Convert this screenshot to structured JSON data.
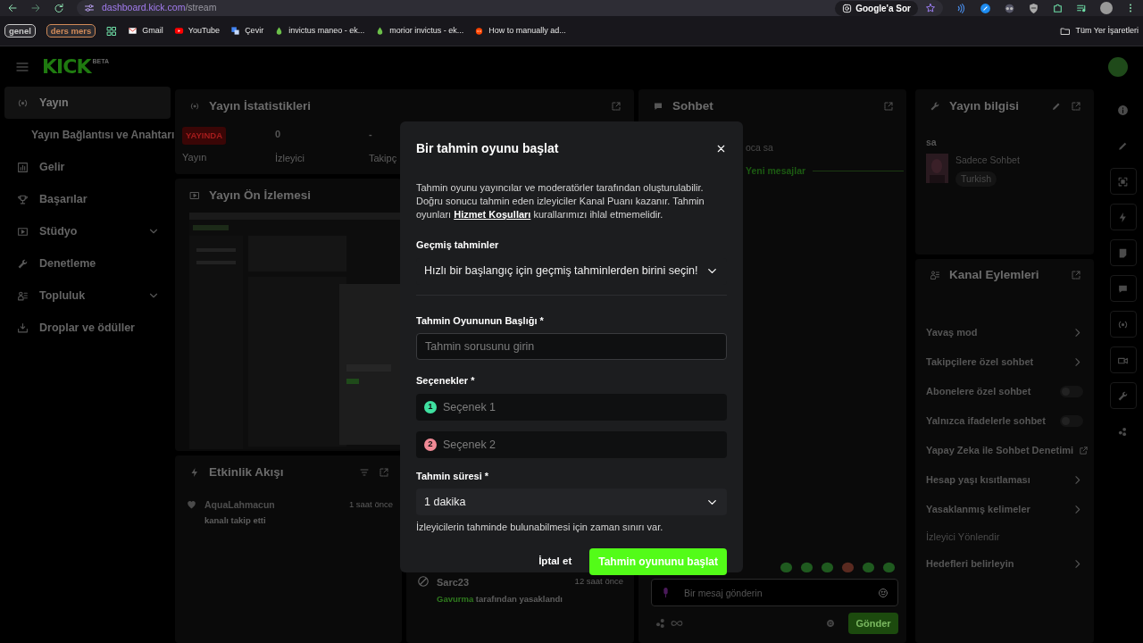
{
  "browser": {
    "url_host": "dashboard.kick.com",
    "url_path": "/stream",
    "ask_button": "Google'a Sor",
    "bookmarks": [
      {
        "kind": "chip",
        "label": "genel",
        "color": "#c8c8c8"
      },
      {
        "kind": "chip",
        "label": "ders mers",
        "color": "#d08a58"
      },
      {
        "kind": "apps"
      },
      {
        "kind": "mail",
        "label": "Gmail"
      },
      {
        "kind": "video",
        "label": "YouTube"
      },
      {
        "kind": "translate",
        "label": "Çevir"
      },
      {
        "kind": "drop",
        "label": "invictus maneo - ek..."
      },
      {
        "kind": "drop",
        "label": "morior invictus - ek..."
      },
      {
        "kind": "site",
        "label": "How to manually ad..."
      }
    ],
    "all_bookmarks": "Tüm Yer İşaretleri"
  },
  "header": {
    "logo": "KICK",
    "logo_badge": "BETA"
  },
  "sidebar": {
    "items": [
      {
        "kind": "main",
        "label": "Yayın",
        "selected": true,
        "expandable": false
      },
      {
        "kind": "sub",
        "label": "Yayın Bağlantısı ve Anahtarı",
        "selected": false,
        "expandable": false
      },
      {
        "kind": "main",
        "label": "Gelir",
        "selected": false,
        "expandable": false
      },
      {
        "kind": "main",
        "label": "Başarılar",
        "selected": false,
        "expandable": false
      },
      {
        "kind": "main",
        "label": "Stüdyo",
        "selected": false,
        "expandable": true
      },
      {
        "kind": "main",
        "label": "Denetleme",
        "selected": false,
        "expandable": false
      },
      {
        "kind": "main",
        "label": "Topluluk",
        "selected": false,
        "expandable": true
      },
      {
        "kind": "main",
        "label": "Droplar ve ödüller",
        "selected": false,
        "expandable": false
      }
    ]
  },
  "stats": {
    "title": "Yayın İstatistikleri",
    "badge": "YAYINDA",
    "badge_label": "Yayın",
    "items": [
      {
        "value": "0",
        "label": "İzleyici"
      },
      {
        "value": "-",
        "label": "Takipç"
      }
    ]
  },
  "preview": {
    "title": "Yayın Ön İzlemesi"
  },
  "activity": {
    "title": "Etkinlik Akışı",
    "events": [
      {
        "user": "AquaLahmacun",
        "action": "kanalı takip etti",
        "time": "1 saat önce"
      }
    ]
  },
  "mod_log": {
    "entries": [
      {
        "user": "Sarc23",
        "moderator": "Gavurma",
        "action": "tarafından yasaklandı",
        "time": "12 saat önce"
      }
    ]
  },
  "chat": {
    "title": "Sohbet",
    "message": "oca sa",
    "new_messages": "Yeni mesajlar",
    "placeholder": "Bir mesaj gönderin",
    "send": "Gönder"
  },
  "info": {
    "title": "Yayın bilgisi",
    "stream_title": "sa",
    "category": "Sadece Sohbet",
    "language": "Turkish"
  },
  "actions": {
    "title": "Kanal Eylemleri",
    "items": [
      {
        "kind": "link",
        "label": "Yavaş mod",
        "disabled": false
      },
      {
        "kind": "link",
        "label": "Takipçilere özel sohbet",
        "disabled": false
      },
      {
        "kind": "toggle",
        "label": "Abonelere özel sohbet",
        "on": false,
        "disabled": false
      },
      {
        "kind": "toggle",
        "label": "Yalnızca ifadelerle sohbet",
        "on": false,
        "disabled": false
      },
      {
        "kind": "external",
        "label": "Yapay Zeka ile Sohbet Denetimi",
        "disabled": false
      },
      {
        "kind": "link",
        "label": "Hesap yaşı kısıtlaması",
        "disabled": false
      },
      {
        "kind": "link",
        "label": "Yasaklanmış kelimeler",
        "disabled": false
      },
      {
        "kind": "plain",
        "label": "İzleyici Yönlendir",
        "disabled": true
      },
      {
        "kind": "link",
        "label": "Hedefleri belirleyin",
        "disabled": false
      }
    ]
  },
  "rail": {
    "icons": [
      {
        "kind": "info",
        "boxed": false
      },
      {
        "kind": "pencil",
        "boxed": false
      },
      {
        "kind": "frame",
        "boxed": true
      },
      {
        "kind": "bolt",
        "boxed": true
      },
      {
        "kind": "doc",
        "boxed": true
      },
      {
        "kind": "chat",
        "boxed": true
      },
      {
        "kind": "broadcast",
        "boxed": true
      },
      {
        "kind": "camera",
        "boxed": true
      },
      {
        "kind": "wrench",
        "boxed": true
      },
      {
        "kind": "dots",
        "boxed": false
      }
    ]
  },
  "modal": {
    "title": "Bir tahmin oyunu başlat",
    "description_before": "Tahmin oyunu yayıncılar ve moderatörler tarafından oluşturulabilir. Doğru sonucu tahmin eden izleyiciler Kanal Puanı kazanır. Tahmin oyunları ",
    "description_link": "Hizmet Koşulları",
    "description_after": " kurallarımızı ihlal etmemelidir.",
    "past": {
      "label": "Geçmiş tahminler",
      "value": "Hızlı bir başlangıç için geçmiş tahminlerden birini seçin!"
    },
    "question": {
      "label": "Tahmin Oyununun Başlığı *",
      "placeholder": "Tahmin sorusunu girin"
    },
    "options": {
      "label": "Seçenekler *",
      "items": [
        {
          "number": "1",
          "placeholder": "Seçenek 1",
          "color": "#3fe0a0"
        },
        {
          "number": "2",
          "placeholder": "Seçenek 2",
          "color": "#f08a96"
        }
      ]
    },
    "duration": {
      "label": "Tahmin süresi *",
      "value": "1 dakika",
      "hint": "İzleyicilerin tahminde bulunabilmesi için zaman sınırı var."
    },
    "cancel": "İptal et",
    "submit": "Tahmin oyununu başlat"
  }
}
